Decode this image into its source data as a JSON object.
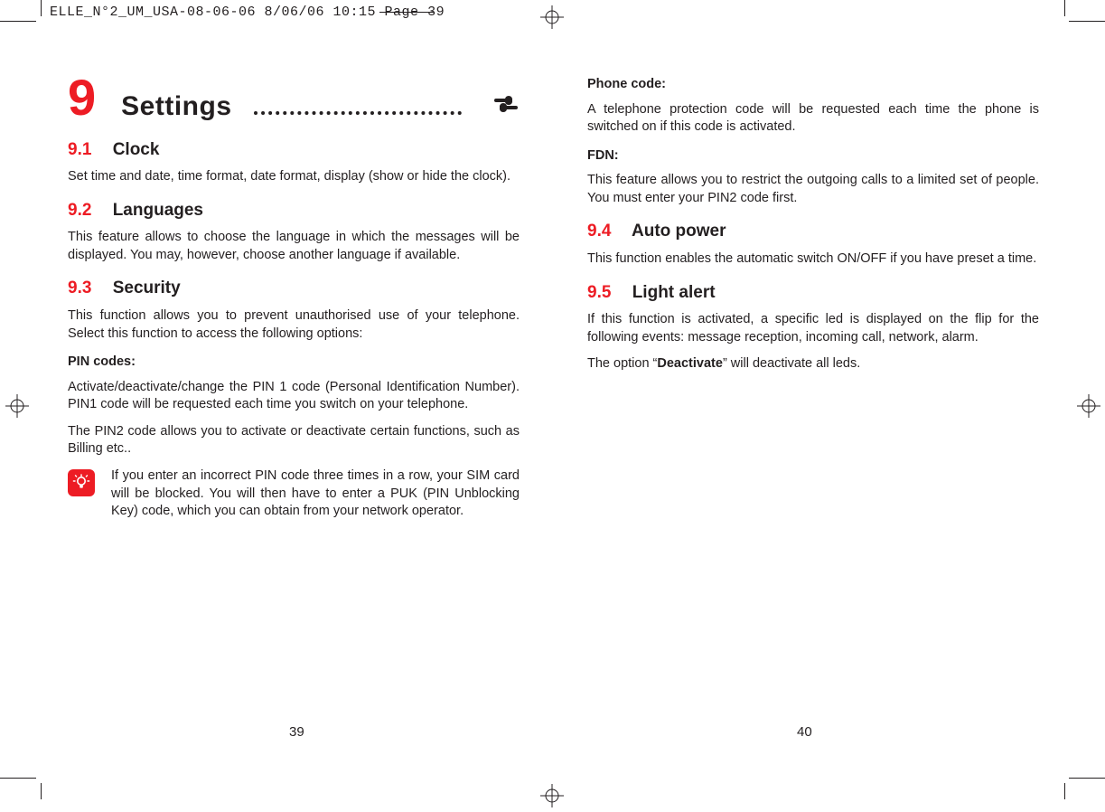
{
  "slug": "ELLE_N°2_UM_USA-08-06-06  8/06/06  10:15  Page 39",
  "chapter": {
    "num": "9",
    "title": "Settings"
  },
  "left": {
    "s91_num": "9.1",
    "s91_title": "Clock",
    "s91_body": "Set time and date, time format, date format, display (show or hide the clock).",
    "s92_num": "9.2",
    "s92_title": "Languages",
    "s92_body": "This feature allows to choose the language in which the messages will be displayed. You may, however, choose another language if available.",
    "s93_num": "9.3",
    "s93_title": "Security",
    "s93_body": "This function allows you to prevent unauthorised use of your telephone. Select this function to access the following options:",
    "pin_sub": "PIN codes:",
    "pin_p1": "Activate/deactivate/change the PIN 1 code (Personal Identification Number). PIN1 code will be requested each time you switch on your telephone.",
    "pin_p2": "The PIN2 code allows you to activate or deactivate certain functions, such as Billing etc..",
    "note": "If you enter an incorrect PIN code three times in a row, your SIM card will be blocked. You will then have to enter a PUK (PIN Unblocking Key) code, which you can obtain from your network operator.",
    "page": "39"
  },
  "right": {
    "phone_sub": "Phone code:",
    "phone_body": "A telephone protection code will be requested each time the phone is switched on if this code is activated.",
    "fdn_sub": "FDN:",
    "fdn_body": "This feature allows you to restrict the outgoing calls to a limited set of people. You must enter your PIN2 code first.",
    "s94_num": "9.4",
    "s94_title": "Auto power",
    "s94_body": "This function enables the automatic switch ON/OFF if you have preset a time.",
    "s95_num": "9.5",
    "s95_title": "Light alert",
    "s95_p1": "If this function is activated, a specific led is displayed on the flip for the following events: message reception, incoming call, network, alarm.",
    "s95_p2a": "The option “",
    "s95_p2b": "Deactivate",
    "s95_p2c": "” will deactivate all leds.",
    "page": "40"
  }
}
